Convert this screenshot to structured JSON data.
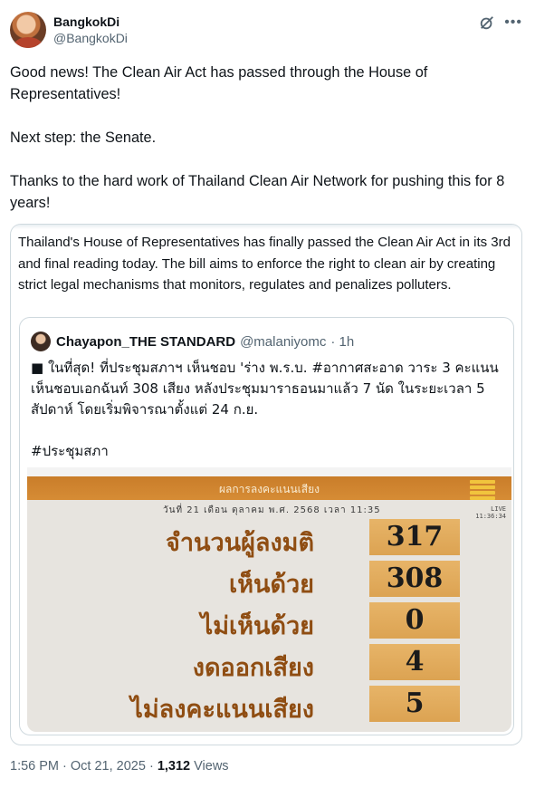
{
  "author": {
    "display_name": "BangkokDi",
    "handle": "@BangkokDi"
  },
  "tweet": {
    "text": "Good news! The Clean Air Act has passed through the House of Representatives!\n\nNext step: the Senate.\n\nThanks to the hard work of Thailand Clean Air Network for pushing this for 8 years!"
  },
  "quoted_tweet": {
    "text": "Thailand's House of Representatives has finally passed the Clean Air Act in its 3rd and final reading today. The bill aims to enforce the right to clean air by creating strict legal mechanisms that monitors, regulates and penalizes polluters.",
    "nested": {
      "display_name": "Chayapon_THE STANDARD",
      "handle": "@malaniyomc",
      "time": "· 1h",
      "text": "■ ในที่สุด! ที่ประชุมสภาฯ เห็นชอบ 'ร่าง พ.ร.บ. #อากาศสะอาด วาระ 3 คะแนนเห็นชอบเอกฉันท์ 308 เสียง หลังประชุมมาราธอนมาแล้ว 7 นัด ในระยะเวลา 5 สัปดาห์ โดยเริ่มพิจารณาตั้งแต่ 24 ก.ย.\n\n#ประชุมสภา",
      "vote_screen": {
        "title": "ผลการลงคะแนนเสียง",
        "date_line": "วันที่ 21 เดือน ตุลาคม พ.ศ. 2568 เวลา 11:35",
        "live_label": "LIVE",
        "clock": "11:36:34",
        "rows": [
          {
            "label": "จำนวนผู้ลงมติ",
            "value": "317"
          },
          {
            "label": "เห็นด้วย",
            "value": "308"
          },
          {
            "label": "ไม่เห็นด้วย",
            "value": "0"
          },
          {
            "label": "งดออกเสียง",
            "value": "4"
          },
          {
            "label": "ไม่ลงคะแนนเสียง",
            "value": "5"
          }
        ]
      }
    }
  },
  "meta": {
    "time": "1:56 PM · Oct 21, 2025 · ",
    "views_count": "1,312",
    "views_label": " Views"
  },
  "colors": {
    "accent_orange": "#d68c35",
    "value_box": "#e0a85a",
    "label_brown": "#8f4d12"
  },
  "icons": [
    "grok-icon",
    "more-icon"
  ]
}
